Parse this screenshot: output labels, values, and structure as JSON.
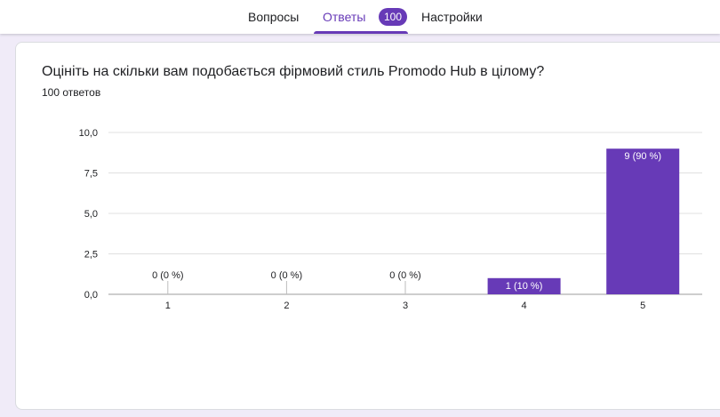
{
  "tabs": {
    "questions_label": "Вопросы",
    "responses_label": "Ответы",
    "responses_count": "100",
    "settings_label": "Настройки"
  },
  "question": {
    "title": "Оцініть на скільки вам подобається фірмовий стиль Promodo Hub в цілому?",
    "response_summary": "100 ответов"
  },
  "colors": {
    "accent": "#673ab7",
    "bar": "#673ab7",
    "grid": "#e0e0e0",
    "text": "#202124"
  },
  "chart_data": {
    "type": "bar",
    "categories": [
      "1",
      "2",
      "3",
      "4",
      "5"
    ],
    "values": [
      0,
      0,
      0,
      1,
      9
    ],
    "data_labels": [
      "0 (0 %)",
      "0 (0 %)",
      "0 (0 %)",
      "1 (10 %)",
      "9 (90 %)"
    ],
    "ylim": [
      0,
      10
    ],
    "yticks": [
      "0,0",
      "2,5",
      "5,0",
      "7,5",
      "10,0"
    ],
    "ytick_values": [
      0,
      2.5,
      5,
      7.5,
      10
    ],
    "grid": true,
    "title": "",
    "xlabel": "",
    "ylabel": ""
  }
}
